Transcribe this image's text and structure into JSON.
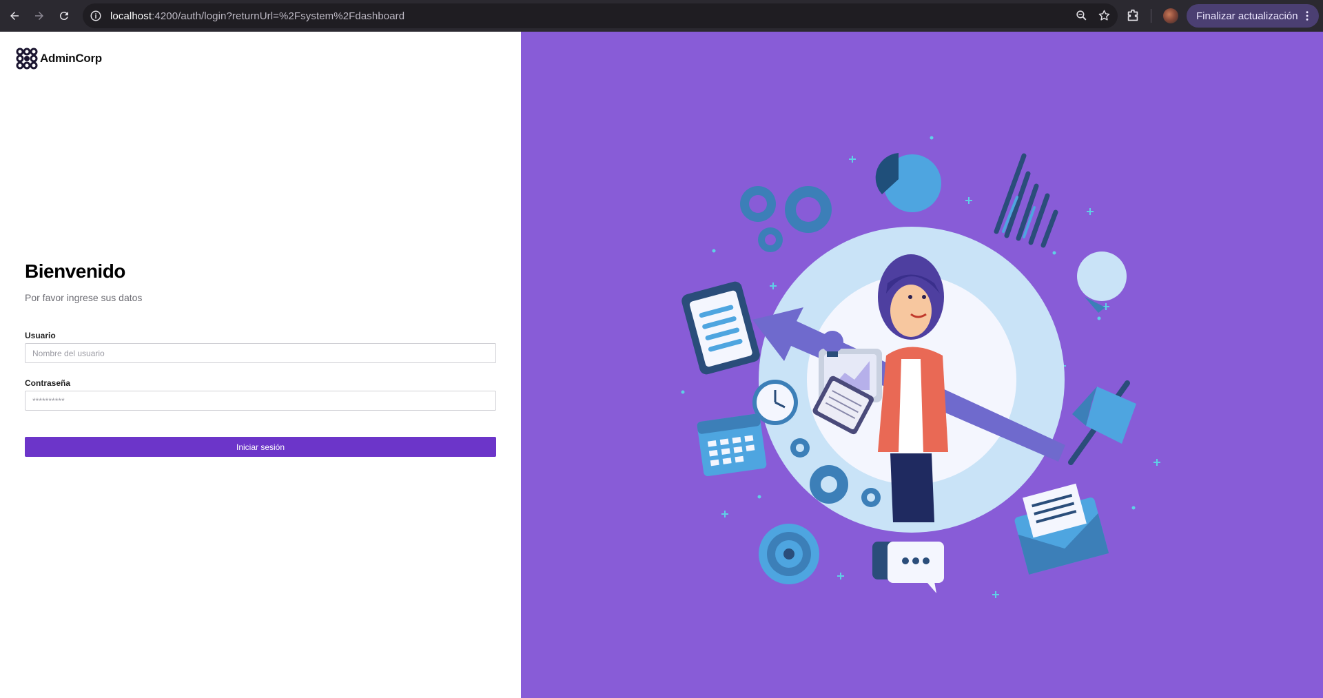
{
  "browser": {
    "url_host": "localhost",
    "url_rest": ":4200/auth/login?returnUrl=%2Fsystem%2Fdashboard",
    "update_button": "Finalizar actualización"
  },
  "brand": {
    "name": "AdminCorp"
  },
  "login": {
    "title": "Bienvenido",
    "subtitle": "Por favor ingrese sus datos",
    "username_label": "Usuario",
    "username_placeholder": "Nombre del usuario",
    "password_label": "Contraseña",
    "password_placeholder": "**********",
    "submit_label": "Iniciar sesión"
  },
  "colors": {
    "accent": "#6c35c9",
    "illustration_bg": "#885cd7"
  }
}
